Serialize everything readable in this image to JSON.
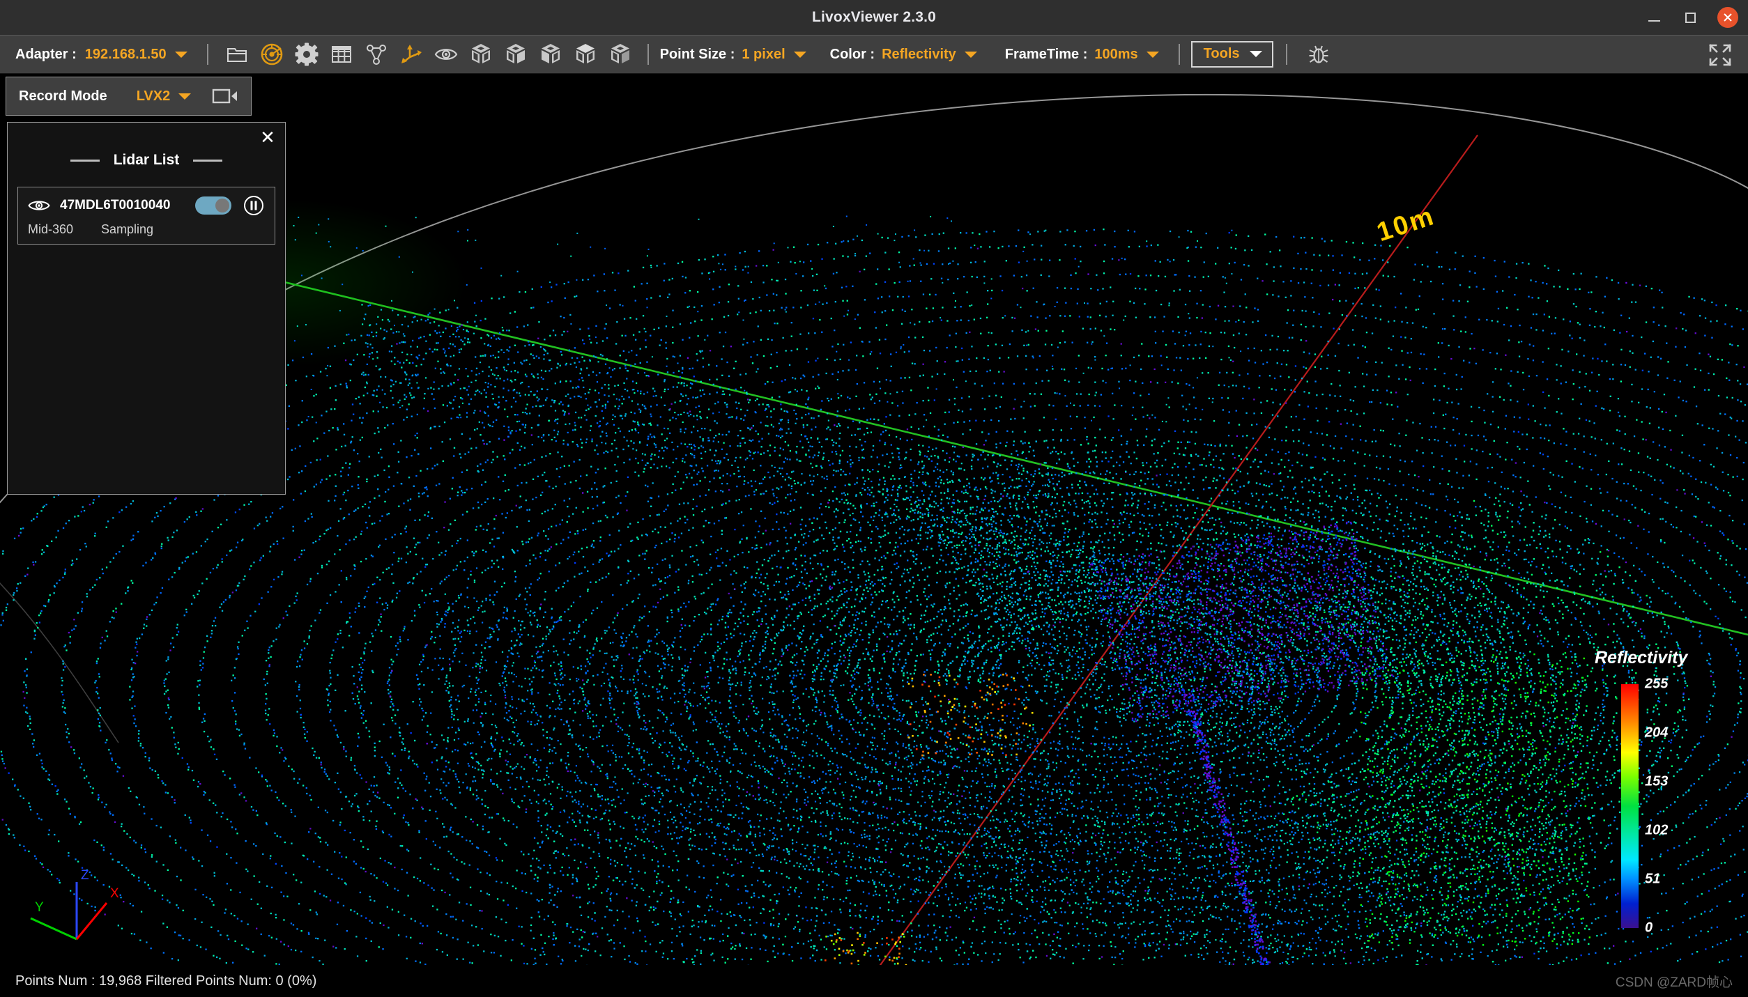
{
  "window": {
    "title": "LivoxViewer 2.3.0",
    "minimize_label": "Minimize",
    "maximize_label": "Maximize",
    "close_label": "Close"
  },
  "toolbar": {
    "adapter_label": "Adapter :",
    "adapter_value": "192.168.1.50",
    "point_size_label": "Point Size :",
    "point_size_value": "1 pixel",
    "color_label": "Color :",
    "color_value": "Reflectivity",
    "frametime_label": "FrameTime :",
    "frametime_value": "100ms",
    "tools_label": "Tools",
    "icons": [
      {
        "name": "open-folder-icon",
        "title": "Open File"
      },
      {
        "name": "lidar-radar-icon",
        "title": "Device Manager"
      },
      {
        "name": "gear-icon",
        "title": "Settings"
      },
      {
        "name": "table-grid-icon",
        "title": "Data Table"
      },
      {
        "name": "network-topology-icon",
        "title": "Topology"
      },
      {
        "name": "axis-gizmo-icon",
        "title": "Coordinate Axis"
      },
      {
        "name": "eye-icon",
        "title": "Visibility"
      },
      {
        "name": "cube-view-front-icon",
        "title": "Front View"
      },
      {
        "name": "cube-view-back-icon",
        "title": "Back View"
      },
      {
        "name": "cube-view-left-icon",
        "title": "Left View"
      },
      {
        "name": "cube-view-top-icon",
        "title": "Top View"
      },
      {
        "name": "cube-view-right-icon",
        "title": "Right View"
      }
    ],
    "bug_icon_title": "Debug",
    "fullscreen_icon_title": "Fullscreen"
  },
  "record": {
    "label": "Record Mode",
    "value": "LVX2",
    "camera_icon_title": "Start Recording"
  },
  "lidar_panel": {
    "title": "Lidar List",
    "close_label": "✕",
    "items": [
      {
        "name": "47MDL6T0010040",
        "model": "Mid-360",
        "state": "Sampling",
        "toggle_on": true,
        "eye_icon_title": "Toggle Visibility",
        "pause_icon_title": "Pause"
      }
    ]
  },
  "viewport": {
    "range_ring_label": "10m",
    "axis_gizmo": {
      "x_label": "X",
      "y_label": "Y",
      "z_label": "Z",
      "x_color": "#ff0000",
      "y_color": "#00d000",
      "z_color": "#2b48ff"
    },
    "axis_line_x_color": "#c01010",
    "axis_line_y_color": "#20c020",
    "range_ring_color": "#b8b8b8"
  },
  "legend": {
    "title": "Reflectivity",
    "ticks": [
      {
        "value": "255",
        "pos": 0
      },
      {
        "value": "204",
        "pos": 20
      },
      {
        "value": "153",
        "pos": 40
      },
      {
        "value": "102",
        "pos": 60
      },
      {
        "value": "51",
        "pos": 80
      },
      {
        "value": "0",
        "pos": 100
      }
    ],
    "colors": {
      "high": "#ff0000",
      "mid": "#ffff00",
      "low": "#00e8ff",
      "min": "#3b1090"
    }
  },
  "statusbar": {
    "points_text": "Points Num : 19,968  Filtered Points Num: 0 (0%)",
    "watermark": "CSDN @ZARD帧心"
  },
  "chart_data": {
    "type": "scatter",
    "title": "Reflectivity",
    "colormap": "jet",
    "value_range": [
      0,
      255
    ],
    "tick_values": [
      0,
      51,
      102,
      153,
      204,
      255
    ],
    "point_count": 19968,
    "filtered_point_count": 0,
    "filtered_percent": "0%"
  }
}
